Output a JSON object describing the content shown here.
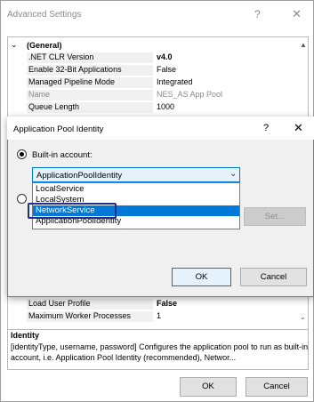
{
  "advanced": {
    "title": "Advanced Settings",
    "help": "?",
    "close": "✕",
    "category": "(General)",
    "rows_top": [
      {
        "name": ".NET CLR Version",
        "value": "v4.0",
        "bold": true
      },
      {
        "name": "Enable 32-Bit Applications",
        "value": "False",
        "bold": false
      },
      {
        "name": "Managed Pipeline Mode",
        "value": "Integrated",
        "bold": false
      },
      {
        "name": "Name",
        "value": "NES_AS App Pool",
        "bold": false,
        "grey": true
      },
      {
        "name": "Queue Length",
        "value": "1000",
        "bold": false
      }
    ],
    "rows_bottom": [
      {
        "name": "Load User Profile",
        "value": "False",
        "bold": true
      },
      {
        "name": "Maximum Worker Processes",
        "value": "1",
        "bold": false
      }
    ],
    "description_title": "Identity",
    "description_text": "[identityType, username, password] Configures the application pool to run as built-in account, i.e. Application Pool Identity (recommended), Networ...",
    "ok_label": "OK",
    "cancel_label": "Cancel"
  },
  "identity_dialog": {
    "title": "Application Pool Identity",
    "help": "?",
    "close": "✕",
    "builtin_label": "Built-in account:",
    "builtin_selected": true,
    "select_value": "ApplicationPoolIdentity",
    "options": [
      "LocalService",
      "LocalSystem",
      "NetworkService",
      "ApplicationPoolIdentity"
    ],
    "highlighted_option": "NetworkService",
    "set_label": "Set...",
    "ok_label": "OK",
    "cancel_label": "Cancel"
  },
  "colors": {
    "highlight": "#0078d7",
    "focus_ring": "#1f2f8a"
  }
}
